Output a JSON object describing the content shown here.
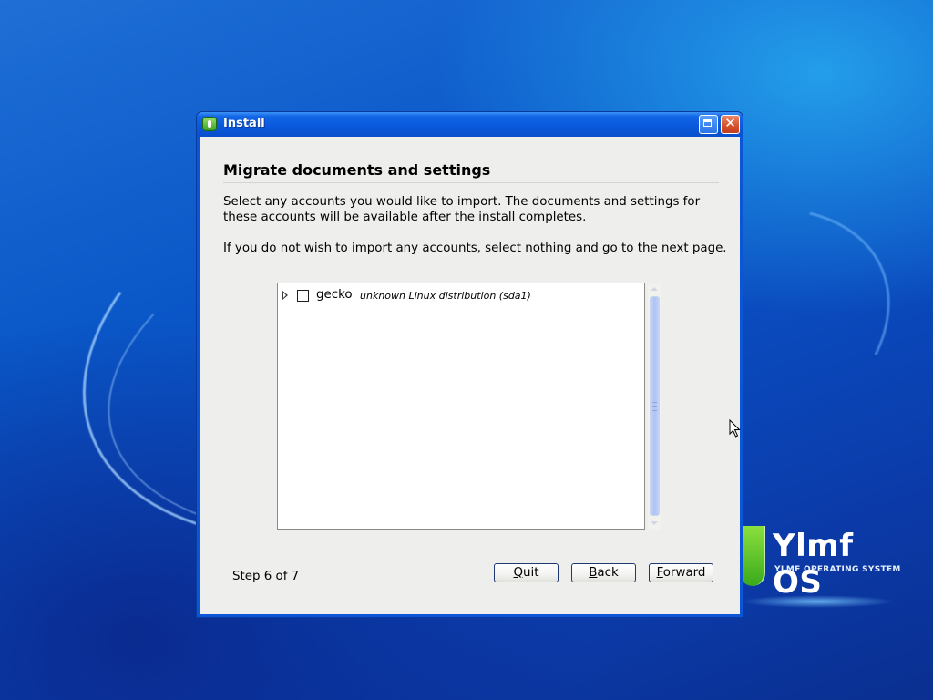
{
  "window": {
    "title": "Install"
  },
  "page": {
    "heading": "Migrate documents and settings",
    "paragraph1_line1": "Select any accounts you would like to import.  The documents and settings for",
    "paragraph1_line2": "these accounts will be available after the install completes.",
    "paragraph2": "If you do not wish to import any accounts, select nothing and go to the next page."
  },
  "accounts": [
    {
      "name": "gecko",
      "detail": "unknown Linux distribution (sda1)",
      "checked": false,
      "expanded": false
    }
  ],
  "footer": {
    "step": "Step 6 of 7",
    "buttons": {
      "quit": {
        "mnemonic": "Q",
        "rest": "uit"
      },
      "back": {
        "mnemonic": "B",
        "rest": "ack"
      },
      "forward": {
        "mnemonic": "F",
        "rest": "orward"
      }
    }
  },
  "titlebar_controls": {
    "close_glyph": "✕"
  },
  "desktop": {
    "brand_name": "Ylmf OS",
    "brand_tagline": "YLMF OPERATING SYSTEM"
  },
  "colors": {
    "titlebar": "#0a58dc",
    "content_bg": "#eeeeec",
    "close_button": "#d4502a",
    "brand_green": "#3aa91b"
  },
  "icons": {
    "title_icon": "installer-icon",
    "maximize": "maximize-icon",
    "close": "close-icon",
    "expander": "chevron-right-icon",
    "checkbox": "checkbox-icon"
  }
}
